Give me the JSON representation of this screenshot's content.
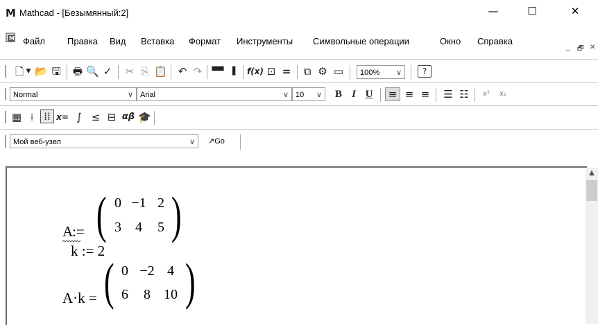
{
  "window": {
    "logo": "M",
    "title": "Mathcad - [Безымянный:2]",
    "minimize": "—",
    "maximize": "☐",
    "close": "✕"
  },
  "menu": [
    {
      "label": "Файл"
    },
    {
      "label": "Правка"
    },
    {
      "label": "Вид"
    },
    {
      "label": "Вставка"
    },
    {
      "label": "Формат"
    },
    {
      "label": "Инструменты"
    },
    {
      "label": "Символьные операции"
    },
    {
      "label": "Окно"
    },
    {
      "label": "Справка"
    }
  ],
  "mdi": {
    "minimize": "_",
    "restore": "🗗",
    "close": "✕"
  },
  "standard_toolbar": {
    "zoom": "100%",
    "help": "?"
  },
  "format_toolbar": {
    "style": "Normal",
    "font": "Arial",
    "size": "10",
    "bold": "B",
    "italic": "I",
    "underline": "U",
    "superscript": "x²",
    "subscript": "x₂"
  },
  "math_toolbar": {
    "evaluate_label": "x=",
    "greek_label": "αβ"
  },
  "web_toolbar": {
    "address": "Мой веб-узел",
    "go": "Go"
  },
  "worksheet": {
    "def_A": {
      "var": "A",
      "op": ":=",
      "matrix": [
        [
          "0",
          "−1",
          "2"
        ],
        [
          "3",
          "4",
          "5"
        ]
      ]
    },
    "def_k": {
      "text": "k := 2"
    },
    "result": {
      "expr": "A·k =",
      "matrix": [
        [
          "0",
          "−2",
          "4"
        ],
        [
          "6",
          "8",
          "10"
        ]
      ]
    }
  }
}
